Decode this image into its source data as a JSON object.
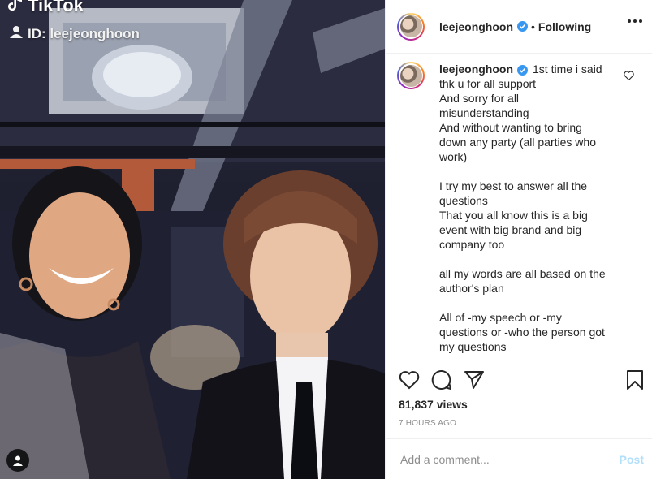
{
  "media": {
    "watermark_brand": "TikTok",
    "watermark_id": "ID: leejeonghoon",
    "icons": {
      "tiktok": "tiktok-note-icon",
      "user": "user-icon",
      "tag": "tag-user-icon"
    }
  },
  "header": {
    "username": "leejeonghoon",
    "separator": "•",
    "follow_status": "Following",
    "more_icon": "more-horizontal-icon",
    "verified_icon": "verified-badge-icon"
  },
  "caption": {
    "username": "leejeonghoon",
    "text": "1st time i said\nthk u for all support\nAnd sorry for all\nmisunderstanding\nAnd without wanting to bring\ndown any party (all parties who\nwork)\n\nI try my best to answer all the\nquestions\nThat you all know this is a big\nevent with big brand and big\ncompany too\n\nall my words are all based on the\nauthor's plan\n\nAll of -my speech or -my\nquestions or -who the person got\nmy questions"
  },
  "actions": {
    "icons": [
      "heart-icon",
      "comment-icon",
      "share-icon",
      "bookmark-icon"
    ]
  },
  "stats": {
    "views": "81,837 views",
    "timestamp": "7 HOURS AGO"
  },
  "comment": {
    "placeholder": "Add a comment...",
    "post_label": "Post"
  },
  "colors": {
    "verified_blue": "#3897f0",
    "post_disabled": "#b2dffc",
    "muted": "#8e8e8e",
    "text": "#262626",
    "border": "#efefef"
  }
}
